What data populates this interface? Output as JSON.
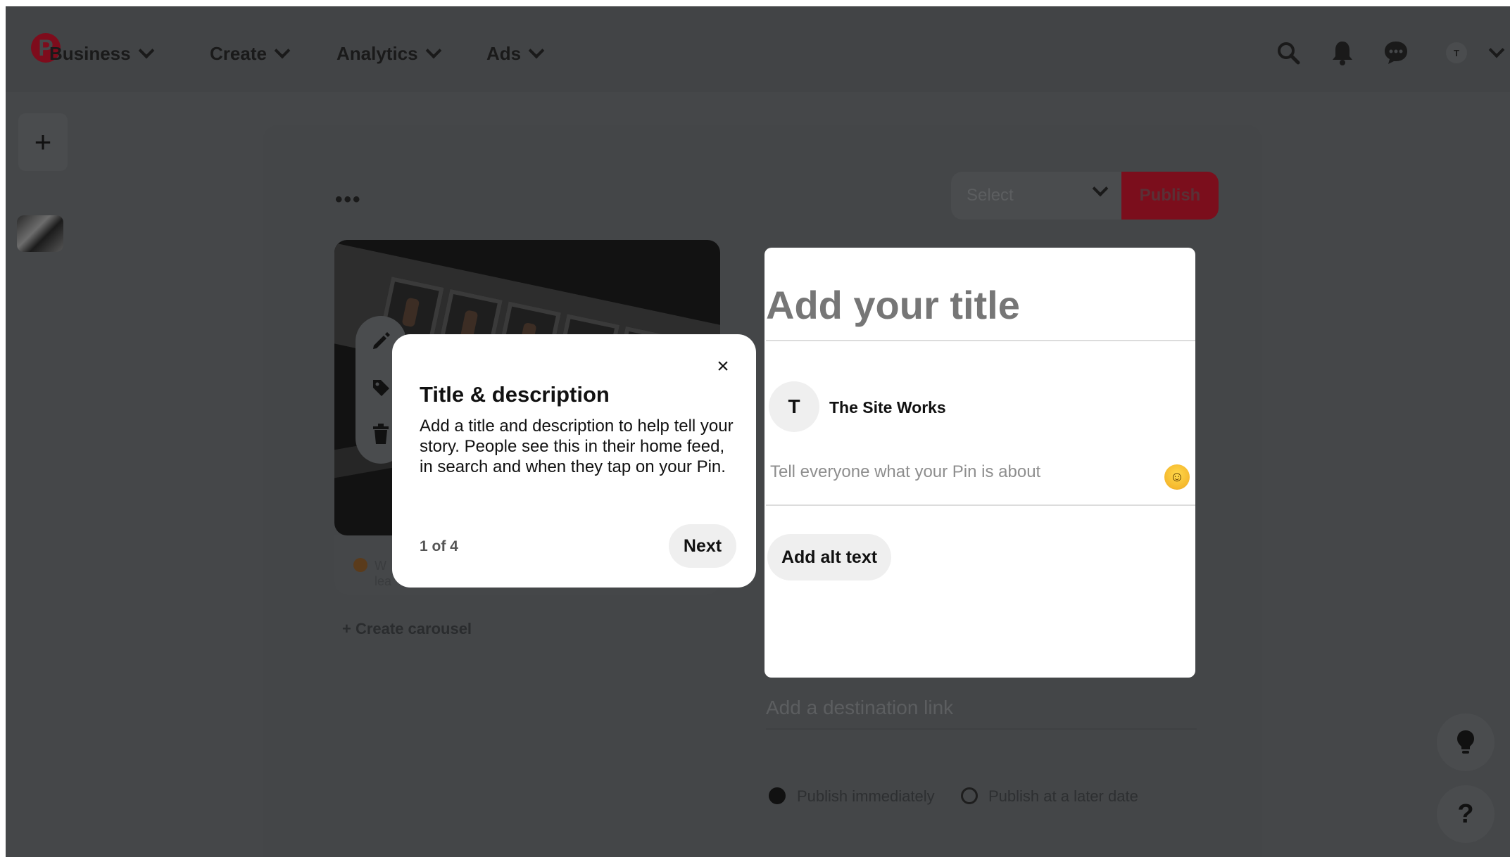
{
  "nav": {
    "business_label": "Business",
    "create_label": "Create",
    "analytics_label": "Analytics",
    "ads_label": "Ads",
    "avatar_initial": "T",
    "icons": [
      "search-icon",
      "bell-icon",
      "chat-icon"
    ]
  },
  "rail": {
    "add_label": "+"
  },
  "toolbar": {
    "more_label": "•••",
    "board_select_value": "Select",
    "publish_label": "Publish"
  },
  "pin": {
    "create_carousel_label": "+ Create carousel",
    "warning_text": "W lea",
    "tool_icons": [
      "pencil-icon",
      "tag-icon",
      "trash-icon"
    ]
  },
  "form": {
    "title_placeholder": "Add your title",
    "author_initial": "T",
    "author_name": "The Site Works",
    "description_placeholder": "Tell everyone what your Pin is about",
    "alt_text_label": "Add alt text",
    "destination_placeholder": "Add a destination link",
    "publish_options": [
      "Publish immediately",
      "Publish at a later date"
    ],
    "selected_publish_option": "Publish immediately"
  },
  "popover": {
    "title": "Title & description",
    "body": "Add a title and description to help tell your story. People see this in their home feed, in search and when they tap on your Pin.",
    "step": "1 of 4",
    "next_label": "Next",
    "close_label": "×"
  },
  "floating": {
    "help_label": "?"
  },
  "colors": {
    "overlay": "#454749",
    "publish": "#7b0e1c",
    "card": "#ffffff"
  }
}
